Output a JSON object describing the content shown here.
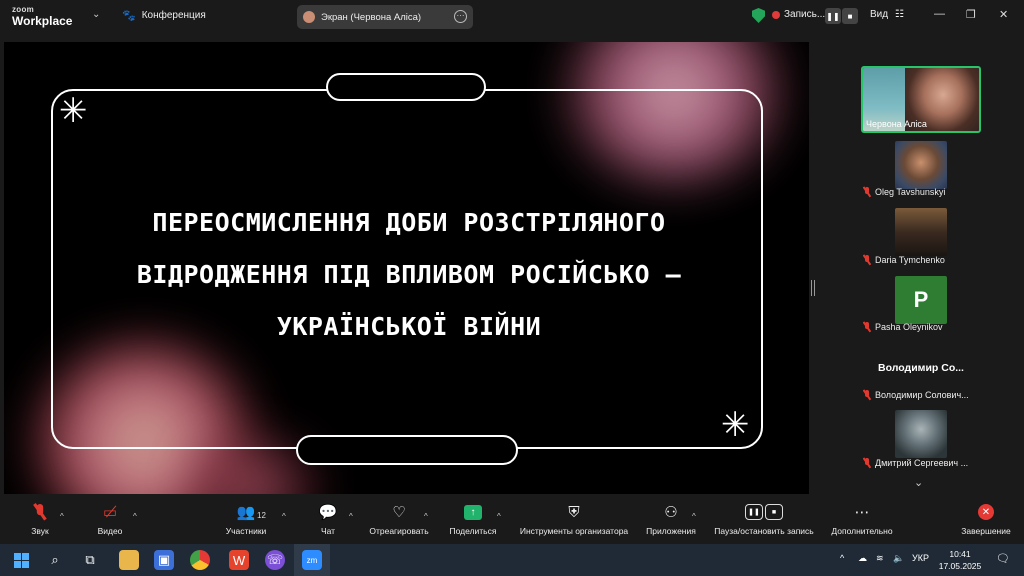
{
  "app": {
    "logo_top": "zoom",
    "logo_bottom": "Workplace",
    "meeting_title": "Конференция",
    "screen_share_label": "Экран (Червона Аліса)",
    "recording_label": "Запись...",
    "view_label": "Вид"
  },
  "slide": {
    "title_line1": "ПЕРЕОСМИСЛЕННЯ ДОБИ РОЗСТРІЛЯНОГО",
    "title_line2": "ВІДРОДЖЕННЯ ПІД ВПЛИВОМ РОСІЙСЬКО –",
    "title_line3": "УКРАЇНСЬКОЇ ВІЙНИ",
    "star_glyph": "✳"
  },
  "gallery": {
    "active_speaker": "Червона Аліса",
    "participants": [
      {
        "name": "Oleg Tavshunskyi"
      },
      {
        "name": "Daria Tymchenko"
      },
      {
        "name": "Pasha Oleynikov",
        "initial": "P"
      },
      {
        "name": "Володимир Солович..."
      },
      {
        "name": "Дмитрий Сергеевич ..."
      }
    ],
    "bold_name": "Володимир Со..."
  },
  "toolbar": {
    "audio": "Звук",
    "video": "Видео",
    "participants": "Участники",
    "participants_count": "12",
    "chat": "Чат",
    "react": "Отреагировать",
    "share": "Поделиться",
    "host_tools": "Инструменты организатора",
    "apps": "Приложения",
    "pause_record": "Пауза/остановить запись",
    "more": "Дополнительно",
    "end": "Завершение"
  },
  "taskbar": {
    "lang": "УКР",
    "time": "10:41",
    "date": "17.05.2025"
  },
  "colors": {
    "accent_green": "#28c46a",
    "end_red": "#e53935",
    "background": "#1a1a1a"
  }
}
